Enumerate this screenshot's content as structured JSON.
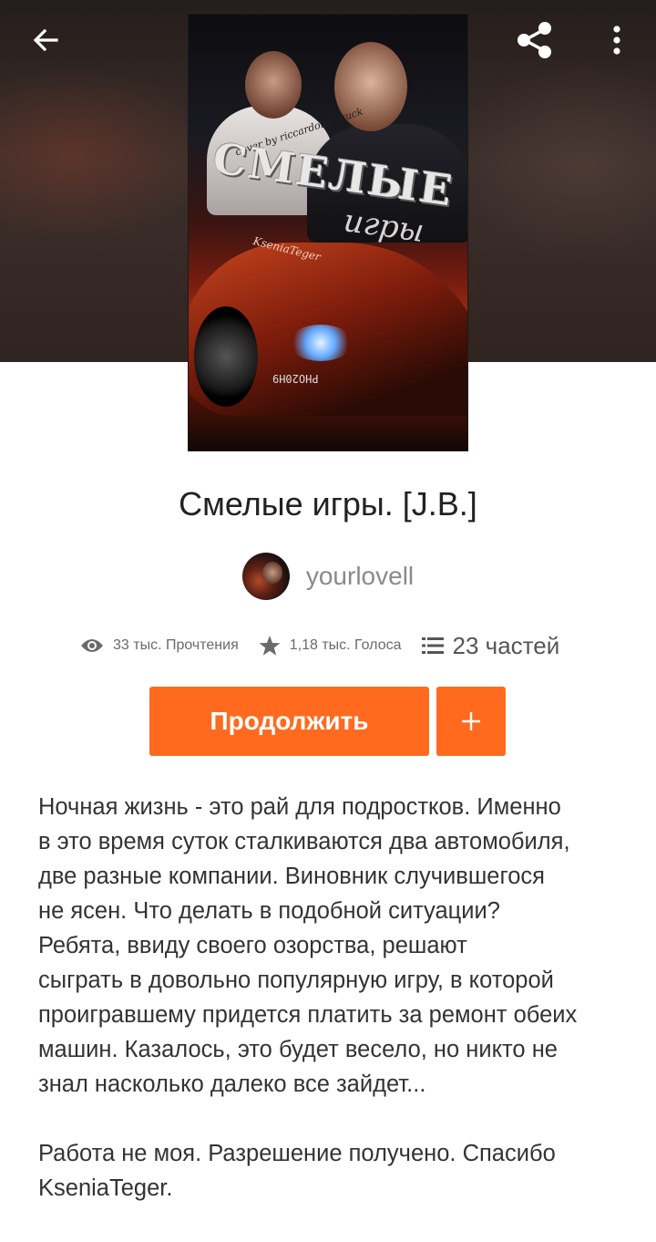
{
  "header": {
    "back_icon": "arrow-left-icon",
    "share_icon": "share-icon",
    "more_icon": "more-vertical-icon"
  },
  "cover": {
    "credit": "cover by riccardolucccuck",
    "title": "СМЕЛЫЕ",
    "subtitle": "игры",
    "author": "KseniaTeger",
    "plate": "PHO20H9"
  },
  "story": {
    "title": "Смелые игры. [J.B.]",
    "author": "yourlovell"
  },
  "stats": {
    "reads": "33 тыс. Прочтения",
    "votes": "1,18 тыс. Голоса",
    "parts": "23 частей"
  },
  "actions": {
    "continue_label": "Продолжить",
    "add_icon": "plus-icon"
  },
  "description": {
    "paragraph1": "Ночная жизнь - это рай для подростков. Именно\nв это время суток сталкиваются два автомобиля,\nдве разные компании. Виновник случившегося\nне ясен. Что делать в подобной ситуации?\nРебята, ввиду своего озорства, решают\nсыграть в довольно популярную игру, в которой\nпроигравшему придется платить за ремонт обеих\nмашин. Казалось, это будет весело, но никто не\nзнал насколько далеко все зайдет...",
    "paragraph2": "Работа не моя. Разрешение получено. Спасибо\nKseniaTeger."
  },
  "colors": {
    "accent": "#ff6a1f",
    "text": "#333333",
    "muted": "#8a8a8a"
  }
}
